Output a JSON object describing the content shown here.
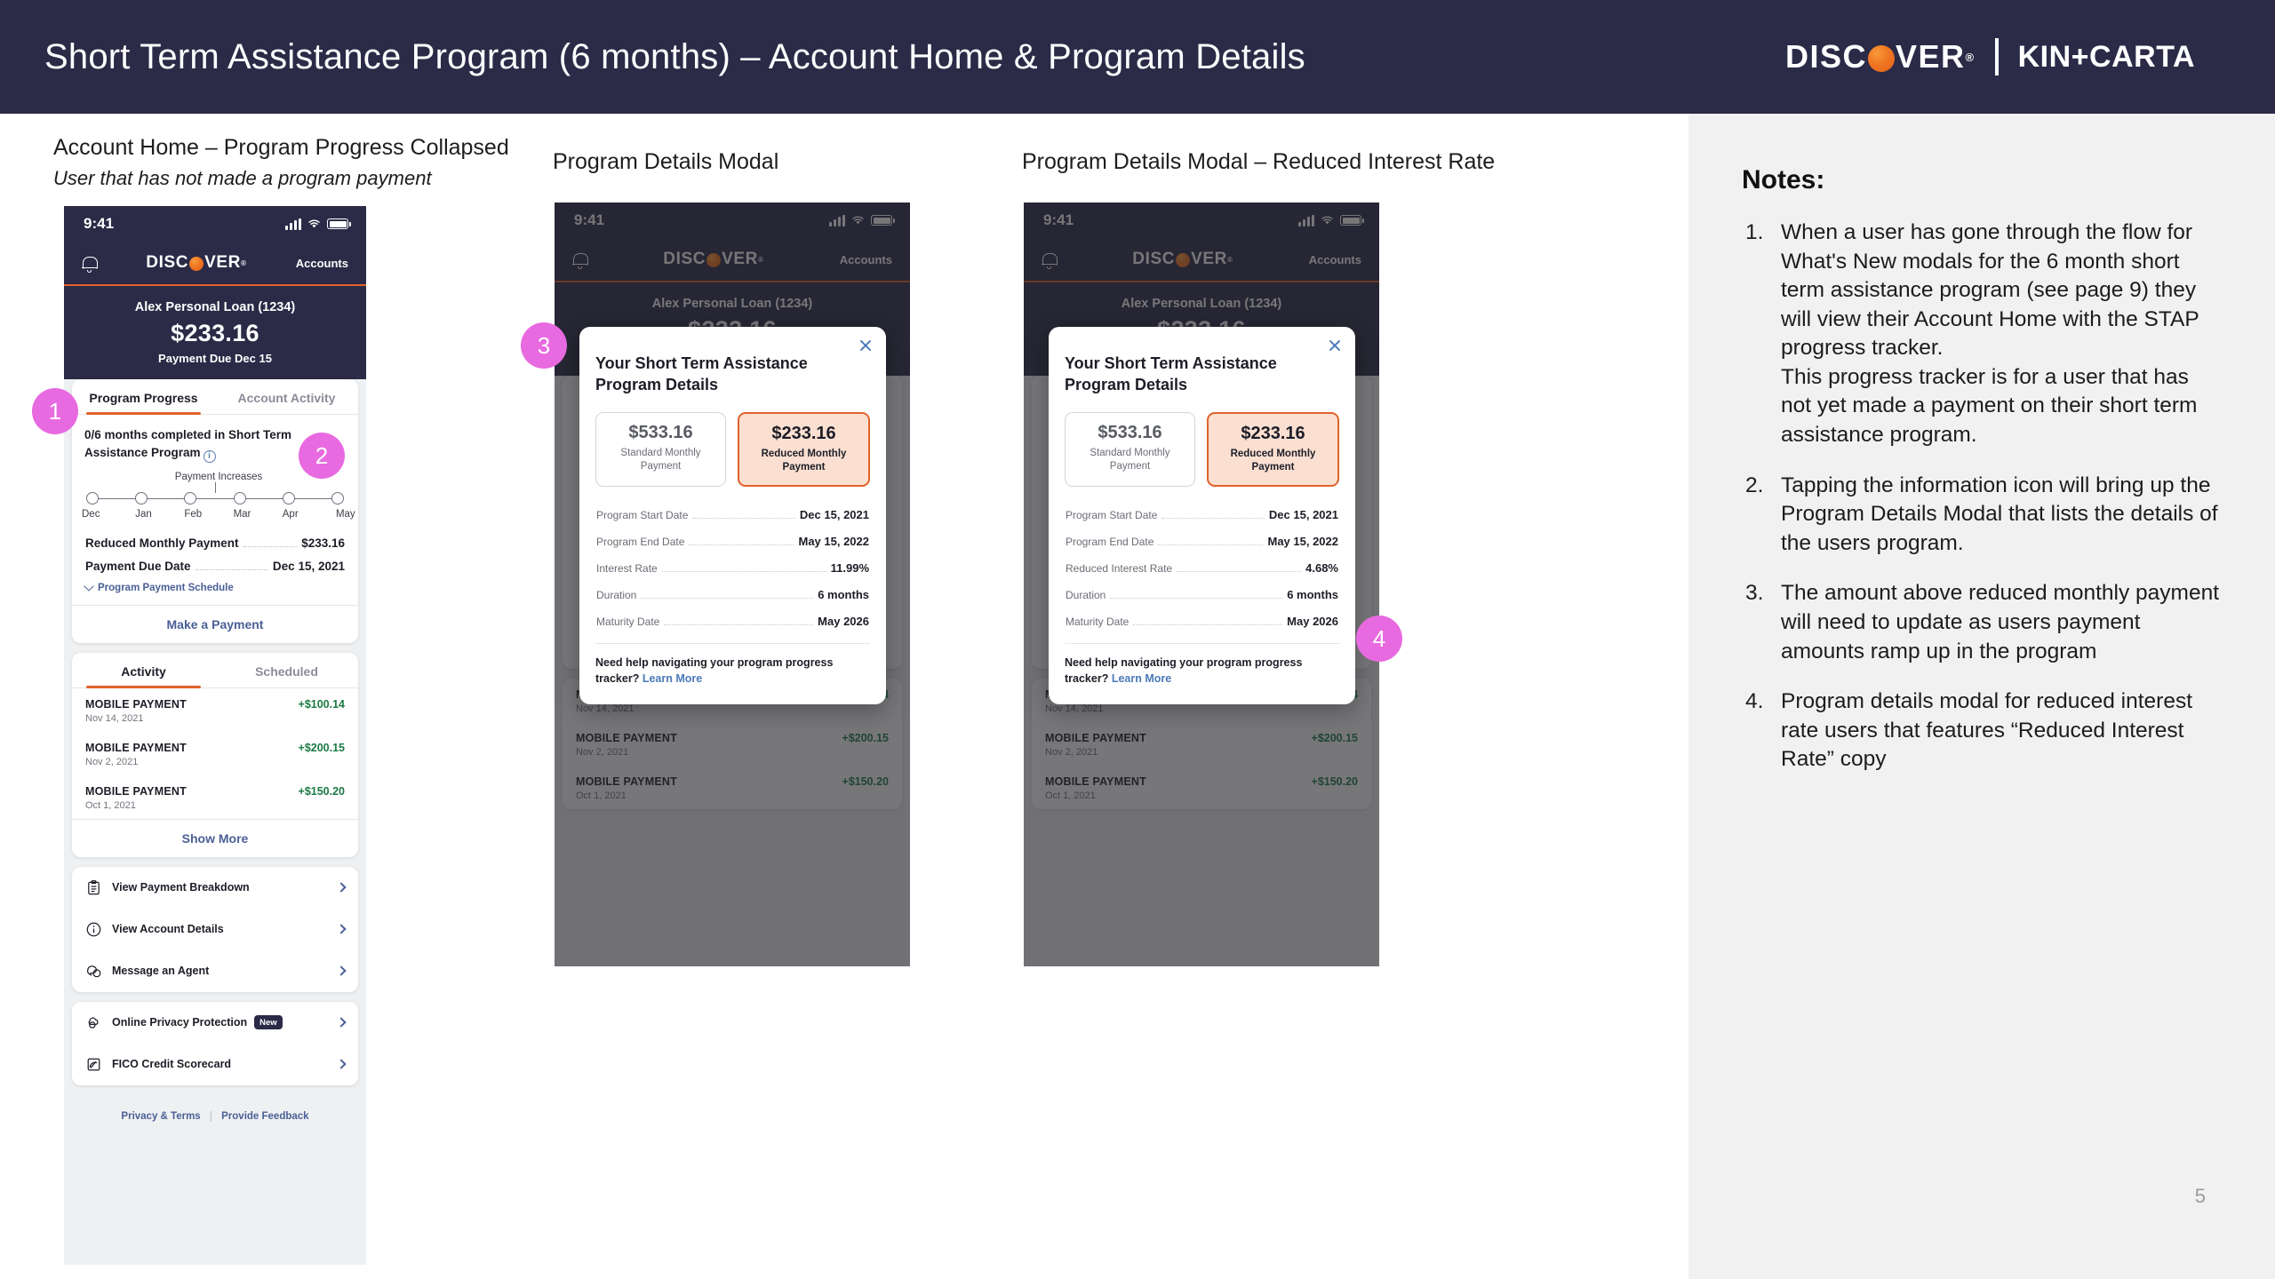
{
  "header": {
    "title": "Short Term Assistance Program (6 months) – Account Home & Program Details",
    "discover_logo": "DISCOVER",
    "kin_carta_logo": "KIN+CARTA"
  },
  "captions": {
    "c1_title": "Account Home – Program Progress Collapsed",
    "c1_sub": "User that has not made a program payment",
    "c2_title": "Program Details Modal",
    "c3_title": "Program Details Modal – Reduced Interest Rate"
  },
  "phone": {
    "status_time": "9:41",
    "app_logo": "DISCOVER",
    "accounts_label": "Accounts",
    "hero": {
      "account_name": "Alex Personal Loan (1234)",
      "amount": "$233.16",
      "due": "Payment Due Dec 15"
    },
    "tabs": [
      {
        "label": "Program Progress",
        "active": true
      },
      {
        "label": "Account Activity",
        "active": false
      }
    ],
    "progress": {
      "headline": "0/6 months completed in Short Term Assistance Program",
      "payment_increases_label": "Payment Increases",
      "months": [
        "Dec",
        "Jan",
        "Feb",
        "Mar",
        "Apr",
        "May"
      ],
      "rows": [
        {
          "key": "Reduced Monthly Payment",
          "value": "$233.16"
        },
        {
          "key": "Payment Due Date",
          "value": "Dec 15, 2021"
        }
      ],
      "schedule_link": "Program Payment Schedule",
      "make_payment": "Make a Payment"
    },
    "activity": {
      "tabs": [
        {
          "label": "Activity",
          "active": true
        },
        {
          "label": "Scheduled",
          "active": false
        }
      ],
      "rows": [
        {
          "title": "MOBILE PAYMENT",
          "date": "Nov 14, 2021",
          "amount": "+$100.14"
        },
        {
          "title": "MOBILE PAYMENT",
          "date": "Nov 2, 2021",
          "amount": "+$200.15"
        },
        {
          "title": "MOBILE PAYMENT",
          "date": "Oct 1, 2021",
          "amount": "+$150.20"
        }
      ],
      "show_more": "Show More"
    },
    "menu_group_1": [
      {
        "label": "View Payment Breakdown",
        "icon": "clipboard-icon"
      },
      {
        "label": "View Account Details",
        "icon": "info-circle-icon"
      },
      {
        "label": "Message an Agent",
        "icon": "chat-bubbles-icon"
      }
    ],
    "menu_group_2": [
      {
        "label": "Online Privacy Protection",
        "icon": "privacy-cloud-icon",
        "badge": "New"
      },
      {
        "label": "FICO Credit Scorecard",
        "icon": "gauge-icon",
        "badge": ""
      }
    ],
    "footer": {
      "privacy": "Privacy & Terms",
      "feedback": "Provide Feedback"
    }
  },
  "modal_standard": {
    "title": "Your Short Term Assistance Program Details",
    "standard_amount": "$533.16",
    "standard_label": "Standard Monthly Payment",
    "reduced_amount": "$233.16",
    "reduced_label": "Reduced Monthly Payment",
    "rows": [
      {
        "key": "Program Start Date",
        "value": "Dec 15, 2021"
      },
      {
        "key": "Program End Date",
        "value": "May 15, 2022"
      },
      {
        "key": "Interest Rate",
        "value": "11.99%"
      },
      {
        "key": "Duration",
        "value": "6 months"
      },
      {
        "key": "Maturity Date",
        "value": "May 2026"
      }
    ],
    "help_text": "Need help navigating your program progress tracker?",
    "help_link": "Learn More"
  },
  "modal_reduced": {
    "title": "Your Short Term Assistance Program Details",
    "standard_amount": "$533.16",
    "standard_label": "Standard Monthly Payment",
    "reduced_amount": "$233.16",
    "reduced_label": "Reduced Monthly Payment",
    "rows": [
      {
        "key": "Program Start Date",
        "value": "Dec 15, 2021"
      },
      {
        "key": "Program End Date",
        "value": "May 15, 2022"
      },
      {
        "key": "Reduced Interest Rate",
        "value": "4.68%"
      },
      {
        "key": "Duration",
        "value": "6 months"
      },
      {
        "key": "Maturity Date",
        "value": "May 2026"
      }
    ],
    "help_text": "Need help navigating your program progress tracker?",
    "help_link": "Learn More"
  },
  "markers": [
    {
      "label": "1"
    },
    {
      "label": "2"
    },
    {
      "label": "3"
    },
    {
      "label": "4"
    }
  ],
  "notes": {
    "title": "Notes:",
    "items": [
      {
        "text": "When a user has gone through the flow for What's New modals for the 6 month short term assistance program (see page 9) they will view their Account Home with the STAP progress tracker.",
        "sub": "This progress tracker is for a user that has not yet made a payment on their short term assistance program."
      },
      {
        "text": "Tapping the information icon will bring up the Program Details Modal that lists the details of the users program.",
        "sub": ""
      },
      {
        "text": "The amount above reduced monthly payment will need to update as users payment amounts ramp up in the program",
        "sub": ""
      },
      {
        "text": "Program details modal for reduced interest rate users that features “Reduced Interest Rate” copy",
        "sub": ""
      }
    ]
  },
  "page_number": "5",
  "colors": {
    "header_navy": "#2b2a47",
    "accent_orange": "#e0622a",
    "marker_pink": "#e86ae0",
    "link_blue": "#4a5f96",
    "green": "#1c7a43",
    "notes_bg": "#f1f1f1"
  }
}
